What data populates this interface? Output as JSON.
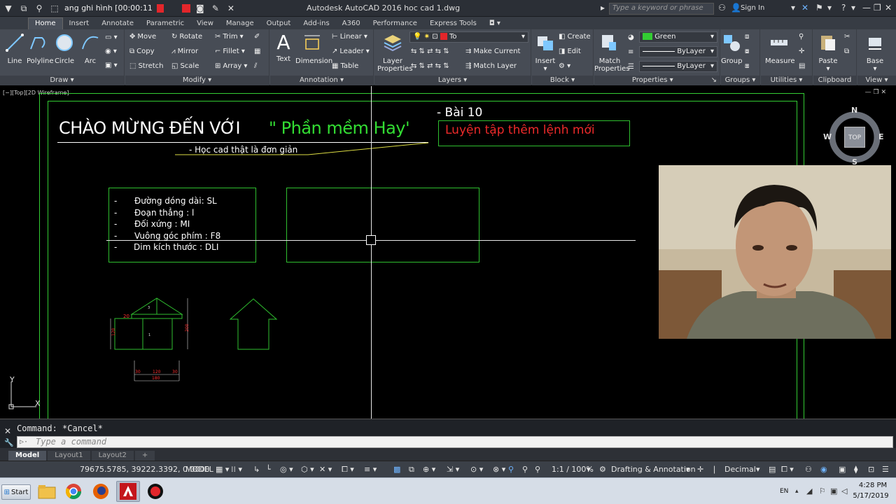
{
  "titlebar": {
    "recorder_label": "ang ghi hình [00:00:11",
    "app_title": "Autodesk AutoCAD 2016    hoc cad 1.dwg",
    "search_placeholder": "Type a keyword or phrase",
    "sign_in": "Sign In"
  },
  "ribbon_tabs": [
    "Home",
    "Insert",
    "Annotate",
    "Parametric",
    "View",
    "Manage",
    "Output",
    "Add-ins",
    "A360",
    "Performance",
    "Express Tools"
  ],
  "ribbon": {
    "draw": {
      "title": "Draw",
      "line": "Line",
      "polyline": "Polyline",
      "circle": "Circle",
      "arc": "Arc"
    },
    "modify": {
      "title": "Modify",
      "move": "Move",
      "rotate": "Rotate",
      "trim": "Trim",
      "copy": "Copy",
      "mirror": "Mirror",
      "fillet": "Fillet",
      "stretch": "Stretch",
      "scale": "Scale",
      "array": "Array"
    },
    "annotation": {
      "title": "Annotation",
      "text": "Text",
      "dimension": "Dimension",
      "linear": "Linear",
      "leader": "Leader",
      "table": "Table"
    },
    "layers": {
      "title": "Layers",
      "layer_properties_1": "Layer",
      "layer_properties_2": "Properties",
      "layer_combo": "To",
      "make_current": "Make Current",
      "match_layer": "Match Layer"
    },
    "block": {
      "title": "Block",
      "insert": "Insert",
      "create": "Create",
      "edit": "Edit"
    },
    "properties": {
      "title": "Properties",
      "match_1": "Match",
      "match_2": "Properties",
      "color": "Green",
      "linetype": "ByLayer",
      "lineweight": "ByLayer"
    },
    "groups": {
      "title": "Groups",
      "group": "Group"
    },
    "utilities": {
      "title": "Utilities",
      "measure": "Measure"
    },
    "clipboard": {
      "title": "Clipboard",
      "paste": "Paste"
    },
    "view": {
      "title": "View",
      "base": "Base"
    }
  },
  "canvas": {
    "viewport_label": "[−][Top][2D Wireframe]",
    "heading_white": "CHÀO MỪNG ĐẾN VỚI",
    "heading_green": "\" Phần mềm Hay'",
    "subtitle": "- Học cad thật là đơn giản",
    "lesson": "- Bài 10",
    "lesson_sub": "Luyện tập thêm lệnh mới",
    "list": [
      {
        "dash": "-",
        "text": "Đường dóng dài: SL"
      },
      {
        "dash": "-",
        "text": "Đoạn thẳng : l"
      },
      {
        "dash": "-",
        "text": "Đối xứng : MI"
      },
      {
        "dash": "-",
        "text": "Vuông góc phím  : F8"
      },
      {
        "dash": "-",
        "text": "Dim kích thước : DLI"
      }
    ],
    "dims": {
      "d3": "3",
      "d20": "20",
      "d1": "1",
      "d120v": "120",
      "d200": "200",
      "d30a": "30",
      "d120h": "120",
      "d30b": "30",
      "d180": "180"
    },
    "viewcube": {
      "n": "N",
      "s": "S",
      "e": "E",
      "w": "W",
      "top": "TOP"
    },
    "ucs": {
      "x": "X",
      "y": "Y"
    }
  },
  "command": {
    "history": "Command: *Cancel*",
    "placeholder": "Type a command"
  },
  "layout_tabs": [
    "Model",
    "Layout1",
    "Layout2"
  ],
  "statusbar": {
    "coords": "79675.5785, 39222.3392, 0.0000",
    "space": "MODEL",
    "scale": "1:1 / 100%",
    "workspace": "Drafting & Annotation",
    "units": "Decimal"
  },
  "taskbar": {
    "start": "Start",
    "lang": "EN",
    "time": "4:28 PM",
    "date": "5/17/2019"
  },
  "colors": {
    "green": "#33cc33",
    "red": "#e3262b",
    "ribbon": "#474c55"
  }
}
